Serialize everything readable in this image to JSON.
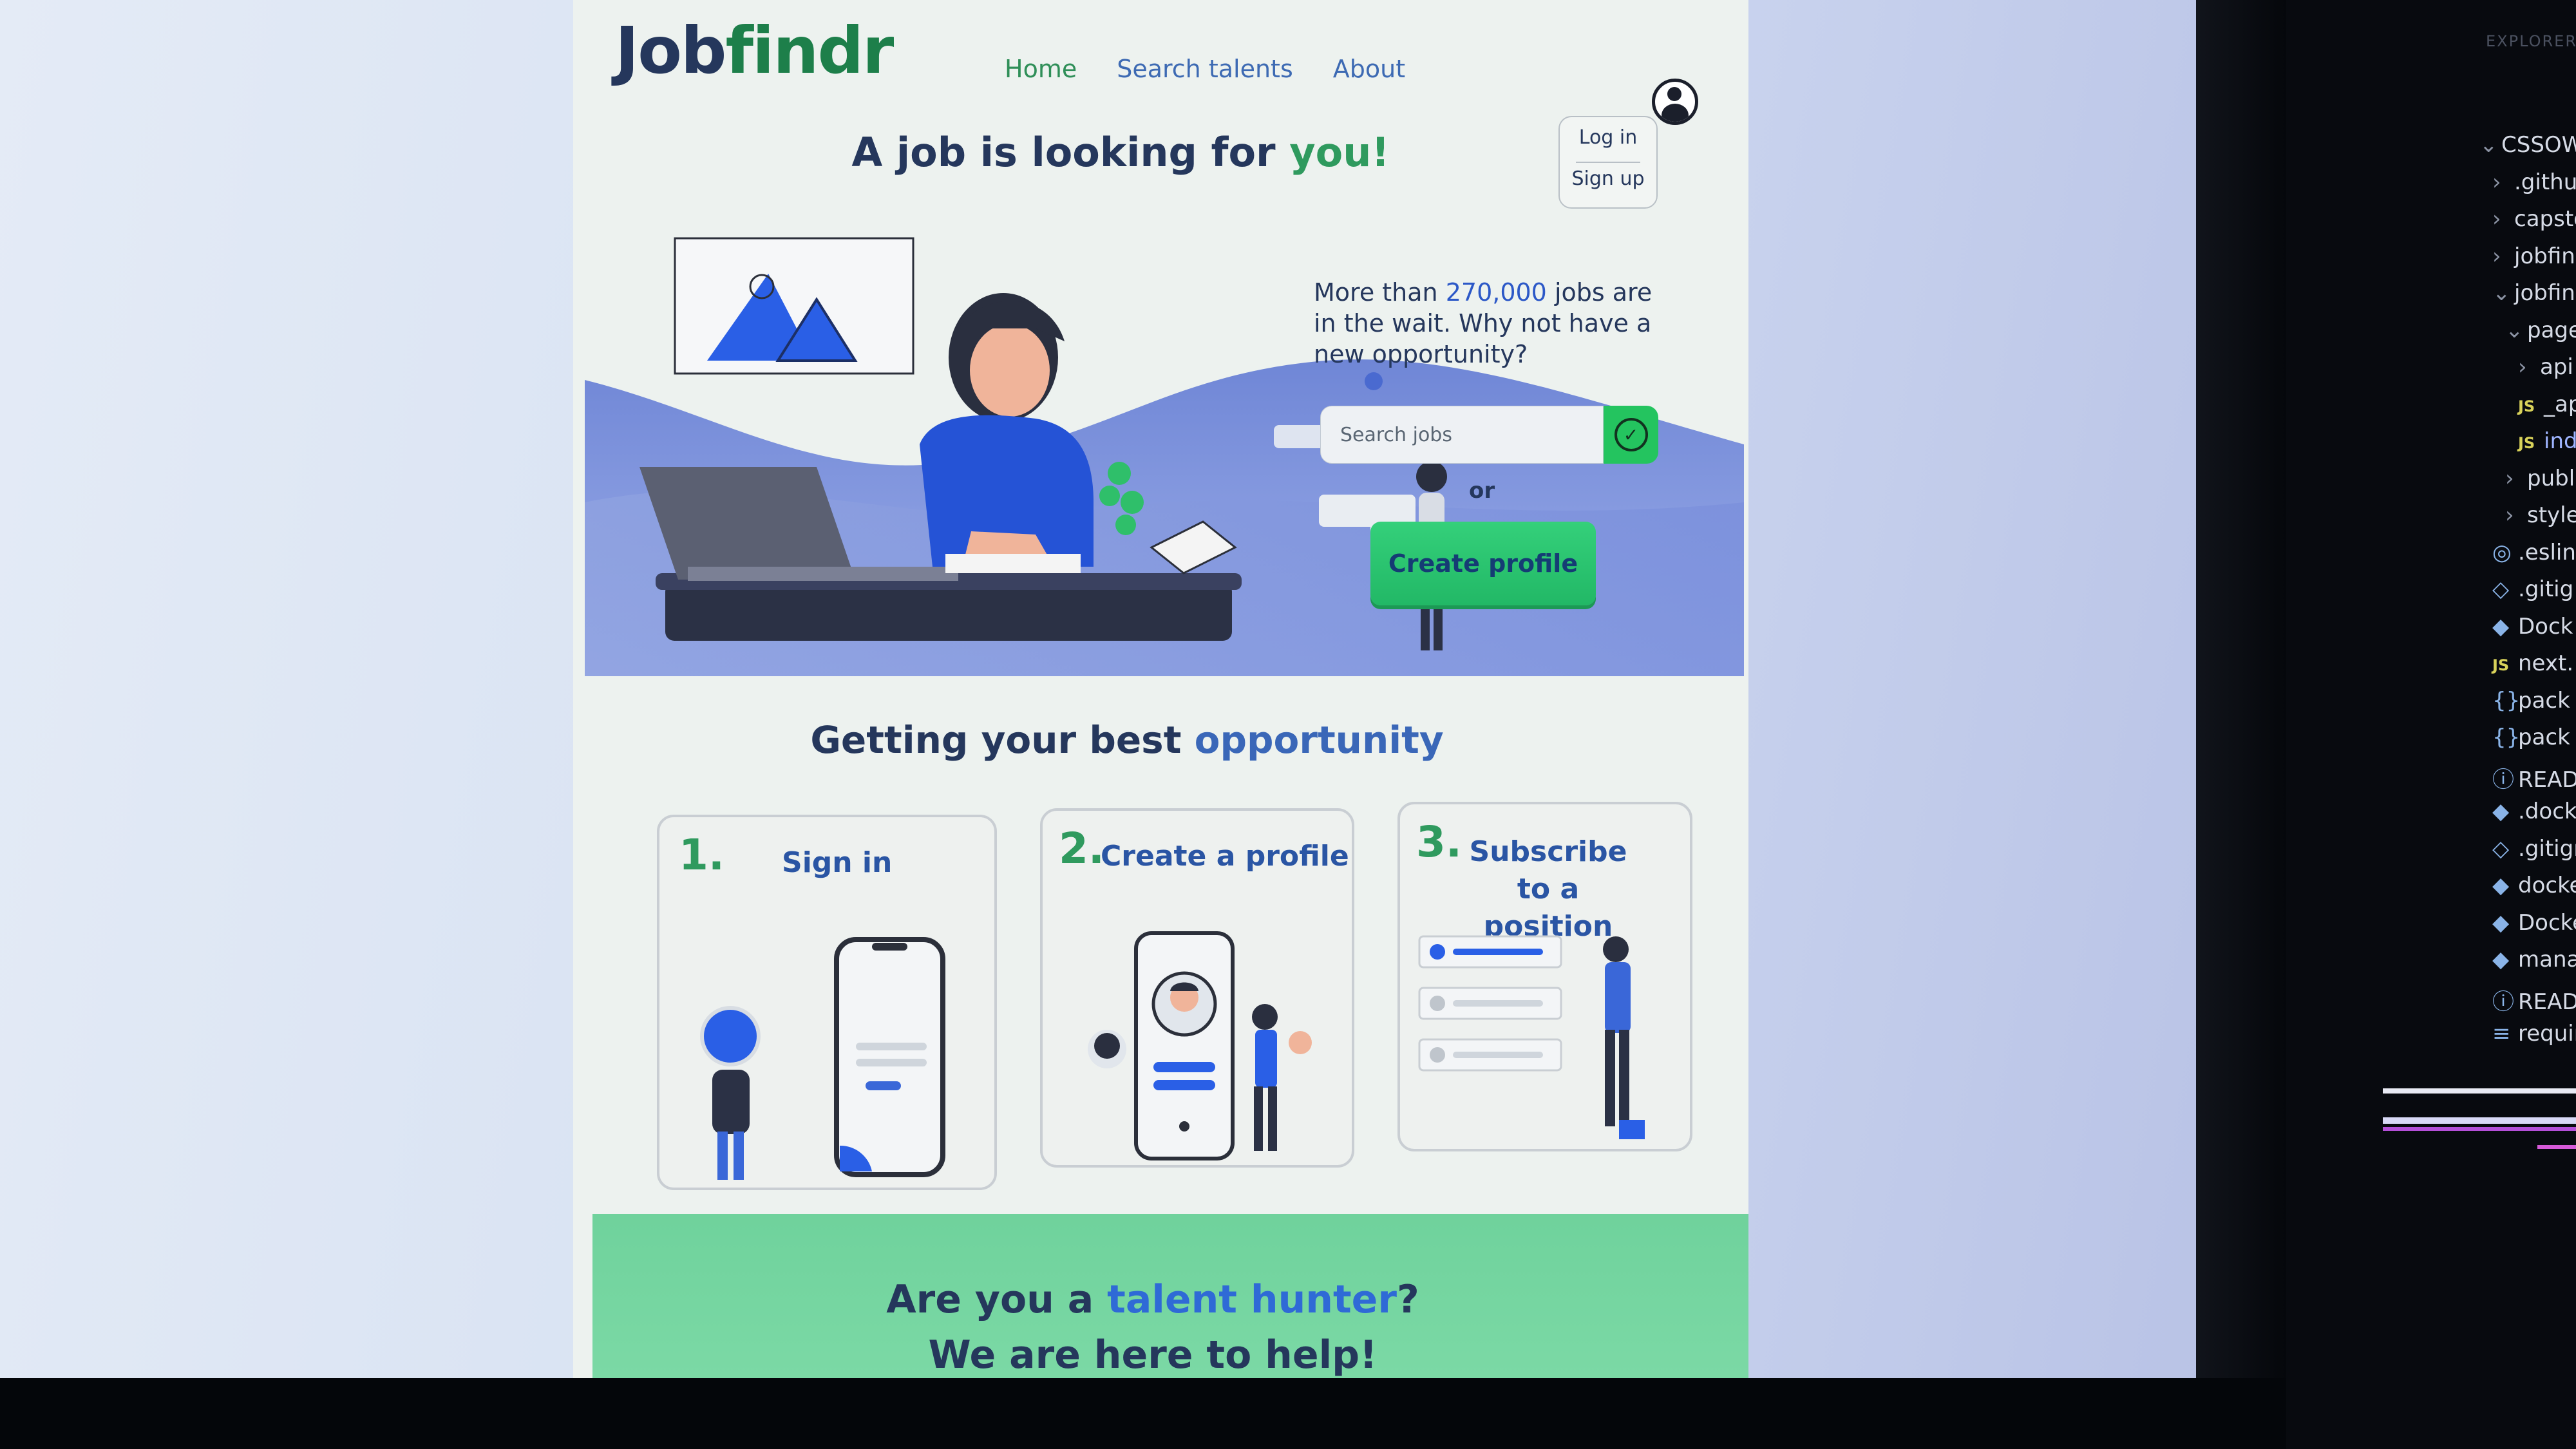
{
  "site": {
    "logo_main": "Job",
    "logo_accent": "findr",
    "nav": [
      "Home",
      "Search talents",
      "About"
    ],
    "auth": {
      "login": "Log in",
      "signup": "Sign up"
    },
    "headline": {
      "prefix": "A job is looking for ",
      "accent": "you!"
    },
    "promo": {
      "line_prefix": "More than ",
      "count": "270,000",
      "line_suffix": " jobs are in the wait. Why not have a new opportunity?"
    },
    "search": {
      "placeholder": "Search jobs"
    },
    "or_label": "or",
    "create_profile": "Create profile",
    "steps_title": {
      "prefix": "Getting your best ",
      "accent": "opportunity"
    },
    "steps": [
      {
        "num": "1.",
        "label": "Sign in"
      },
      {
        "num": "2.",
        "label": "Create a profile"
      },
      {
        "num": "3.",
        "label": "Subscribe to a position"
      }
    ],
    "talent": {
      "prefix": "Are you a ",
      "accent": "talent hunter",
      "suffix": "?",
      "line2": "We are here to help!"
    },
    "colors": {
      "primary_green": "#2f9a5e",
      "button_green": "#24c45f",
      "navy": "#25375c",
      "accent_blue": "#2c58c7"
    }
  },
  "editor": {
    "explorer_label": "EXPLORER",
    "tree": [
      {
        "chevron": "⌄",
        "label": "CSSOWE..."
      },
      {
        "chevron": "›",
        "label": ".github"
      },
      {
        "chevron": "›",
        "label": "capsto"
      },
      {
        "chevron": "›",
        "label": "jobfind"
      },
      {
        "chevron": "⌄",
        "label": "jobfind"
      },
      {
        "chevron": "⌄",
        "label": "pages"
      },
      {
        "chevron": "›",
        "label": "api"
      },
      {
        "badge": "JS",
        "label": "_app"
      },
      {
        "badge": "JS",
        "label": "inde"
      },
      {
        "chevron": "›",
        "label": "publi"
      },
      {
        "chevron": "›",
        "label": "styles"
      },
      {
        "icon": "◎",
        "label": ".eslin"
      },
      {
        "icon": "◇",
        "label": ".gitig"
      },
      {
        "icon": "◆",
        "label": "Dock"
      },
      {
        "badge": "JS",
        "label": "next."
      },
      {
        "icon": "{}",
        "label": "pack"
      },
      {
        "icon": "{}",
        "label": "pack"
      },
      {
        "icon": "ⓘ",
        "label": "READ"
      },
      {
        "icon": "◆",
        "label": ".docke"
      },
      {
        "icon": "◇",
        "label": ".gitign"
      },
      {
        "icon": "◆",
        "label": "docke"
      },
      {
        "icon": "◆",
        "label": "Docke"
      },
      {
        "icon": "◆",
        "label": "manag"
      },
      {
        "icon": "ⓘ",
        "label": "READI"
      },
      {
        "icon": "≡",
        "label": "requir"
      }
    ]
  }
}
